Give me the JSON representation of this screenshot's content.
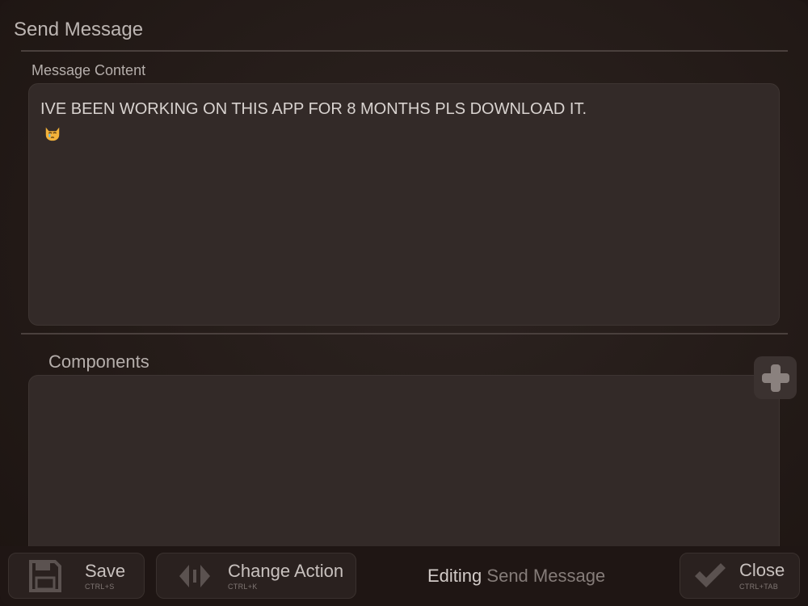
{
  "dialog": {
    "title": "Send Message"
  },
  "message_section": {
    "label": "Message Content",
    "content": "IVE BEEN WORKING ON THIS APP FOR 8 MONTHS PLS DOWNLOAD IT.",
    "emoji": "crying-cat-face"
  },
  "components_section": {
    "label": "Components",
    "add_icon": "plus-icon"
  },
  "footer": {
    "save": {
      "label": "Save",
      "shortcut": "CTRL+S",
      "icon": "floppy-disk-icon"
    },
    "change_action": {
      "label": "Change Action",
      "shortcut": "CTRL+K",
      "icon": "swap-arrows-icon"
    },
    "status": {
      "prefix": "Editing",
      "action": "Send Message"
    },
    "close": {
      "label": "Close",
      "shortcut": "CTRL+TAB",
      "icon": "checkmark-icon"
    }
  },
  "colors": {
    "background": "#241b18",
    "panel": "#332a28",
    "text": "#cfc8c5",
    "muted": "#857c79"
  }
}
